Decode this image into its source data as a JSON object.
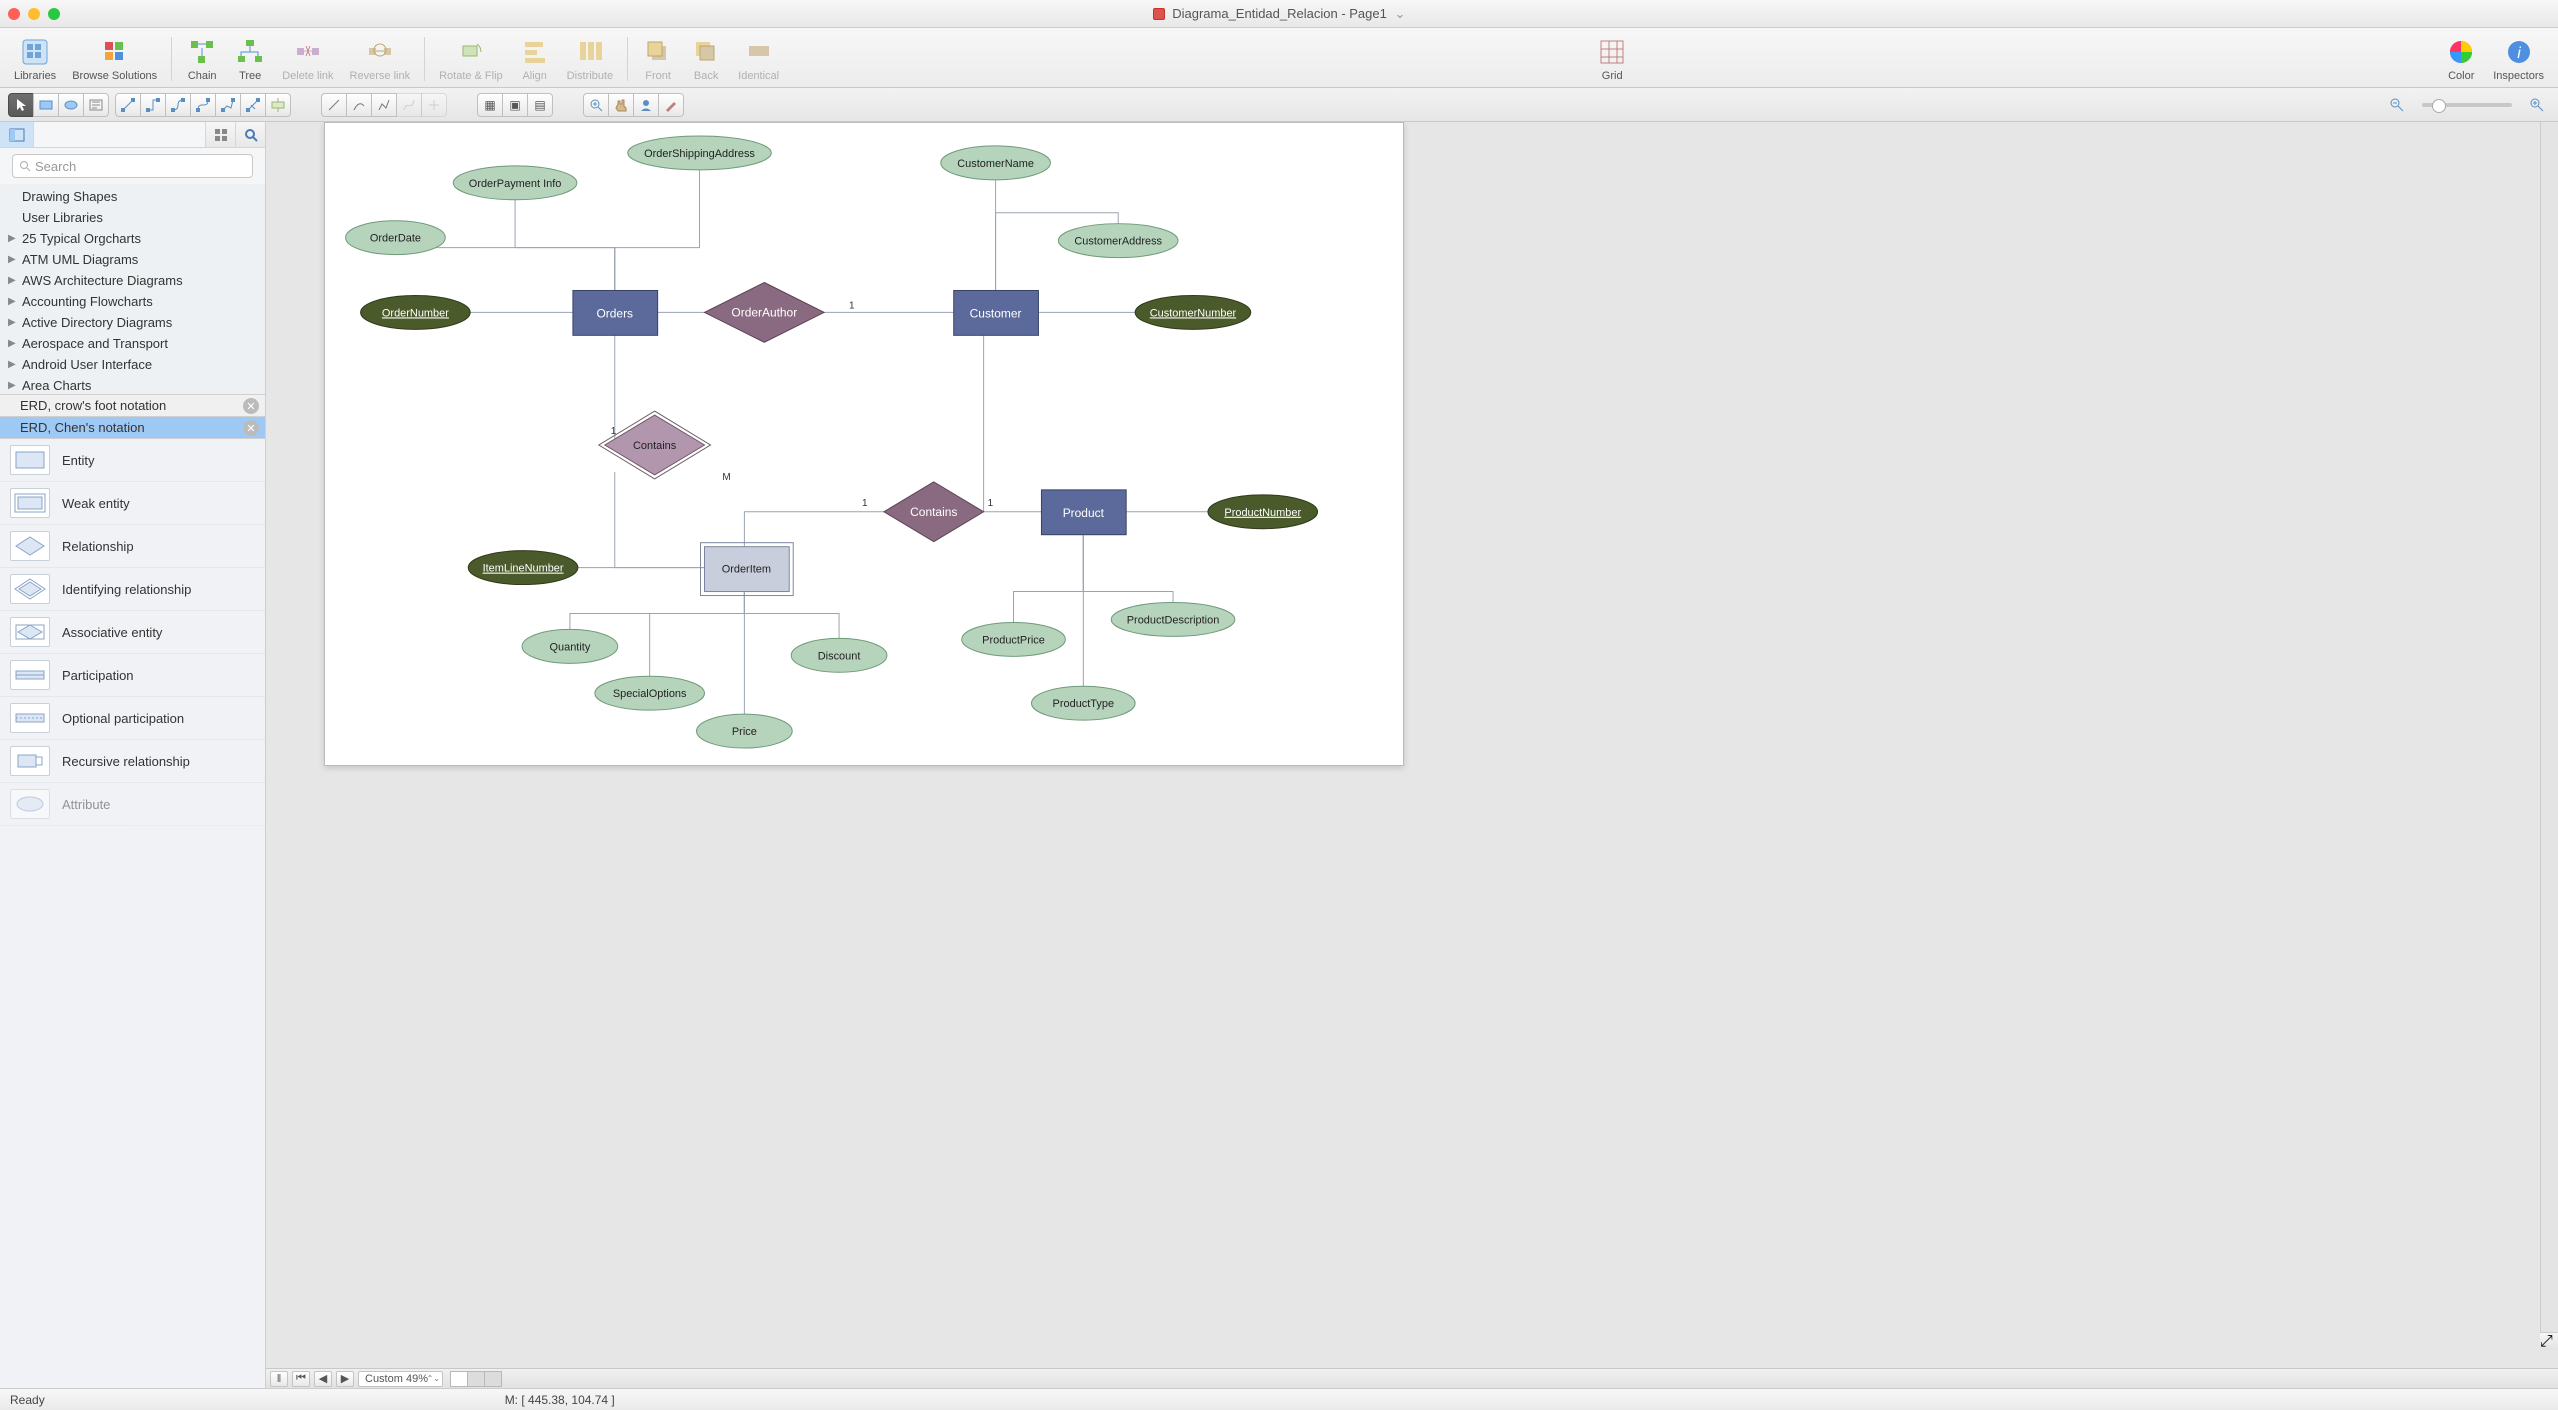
{
  "window": {
    "title": "Diagrama_Entidad_Relacion - Page1"
  },
  "toolbar": {
    "libraries": "Libraries",
    "browse": "Browse Solutions",
    "chain": "Chain",
    "tree": "Tree",
    "delete_link": "Delete link",
    "reverse_link": "Reverse link",
    "rotate_flip": "Rotate & Flip",
    "align": "Align",
    "distribute": "Distribute",
    "front": "Front",
    "back": "Back",
    "identical": "Identical",
    "grid": "Grid",
    "color": "Color",
    "inspectors": "Inspectors"
  },
  "search": {
    "placeholder": "Search"
  },
  "libraries": {
    "top_items": [
      "Drawing Shapes",
      "User Libraries",
      "25 Typical Orgcharts",
      "ATM UML Diagrams",
      "AWS Architecture Diagrams",
      "Accounting Flowcharts",
      "Active Directory Diagrams",
      "Aerospace and Transport",
      "Android User Interface",
      "Area Charts"
    ],
    "open": [
      {
        "name": "ERD, crow's foot notation",
        "selected": false
      },
      {
        "name": "ERD, Chen's notation",
        "selected": true
      }
    ]
  },
  "shapes": [
    "Entity",
    "Weak entity",
    "Relationship",
    "Identifying relationship",
    "Associative entity",
    "Participation",
    "Optional participation",
    "Recursive relationship",
    "Attribute"
  ],
  "erd": {
    "orders": "Orders",
    "customer": "Customer",
    "product": "Product",
    "orderitem": "OrderItem",
    "order_author": "OrderAuthor",
    "contains1": "Contains",
    "contains2": "Contains",
    "order_number": "OrderNumber",
    "customer_number": "CustomerNumber",
    "product_number": "ProductNumber",
    "itemline_number": "ItemLineNumber",
    "order_date": "OrderDate",
    "order_payment": "OrderPayment Info",
    "order_shipping": "OrderShippingAddress",
    "customer_name": "CustomerName",
    "customer_address": "CustomerAddress",
    "quantity": "Quantity",
    "special_options": "SpecialOptions",
    "price": "Price",
    "discount": "Discount",
    "product_price": "ProductPrice",
    "product_type": "ProductType",
    "product_desc": "ProductDescription",
    "card_M": "M",
    "card_1": "1"
  },
  "bottom": {
    "zoom": "Custom 49%"
  },
  "status": {
    "ready": "Ready",
    "coords": "M: [ 445.38, 104.74 ]"
  }
}
